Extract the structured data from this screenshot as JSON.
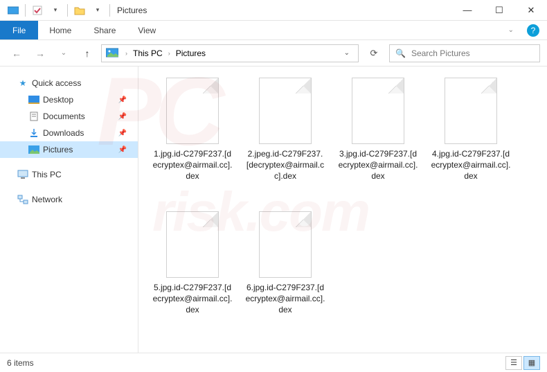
{
  "titlebar": {
    "title": "Pictures"
  },
  "window_controls": {
    "minimize": "—",
    "maximize": "☐",
    "close": "✕"
  },
  "ribbon": {
    "file": "File",
    "tabs": [
      "Home",
      "Share",
      "View"
    ]
  },
  "breadcrumb": {
    "items": [
      "This PC",
      "Pictures"
    ]
  },
  "navbar": {
    "refresh": "⟳"
  },
  "search": {
    "placeholder": "Search Pictures"
  },
  "sidebar": {
    "quick_access": "Quick access",
    "items": [
      {
        "label": "Desktop",
        "icon": "desktop"
      },
      {
        "label": "Documents",
        "icon": "documents"
      },
      {
        "label": "Downloads",
        "icon": "downloads"
      },
      {
        "label": "Pictures",
        "icon": "pictures",
        "selected": true
      }
    ],
    "this_pc": "This PC",
    "network": "Network"
  },
  "files": [
    "1.jpg.id-C279F237.[decryptex@airmail.cc].dex",
    "2.jpeg.id-C279F237.[decryptex@airmail.cc].dex",
    "3.jpg.id-C279F237.[decryptex@airmail.cc].dex",
    "4.jpg.id-C279F237.[decryptex@airmail.cc].dex",
    "5.jpg.id-C279F237.[decryptex@airmail.cc].dex",
    "6.jpg.id-C279F237.[decryptex@airmail.cc].dex"
  ],
  "statusbar": {
    "count": "6 items"
  },
  "watermark": {
    "line1": "PC",
    "line2": "risk.com"
  }
}
